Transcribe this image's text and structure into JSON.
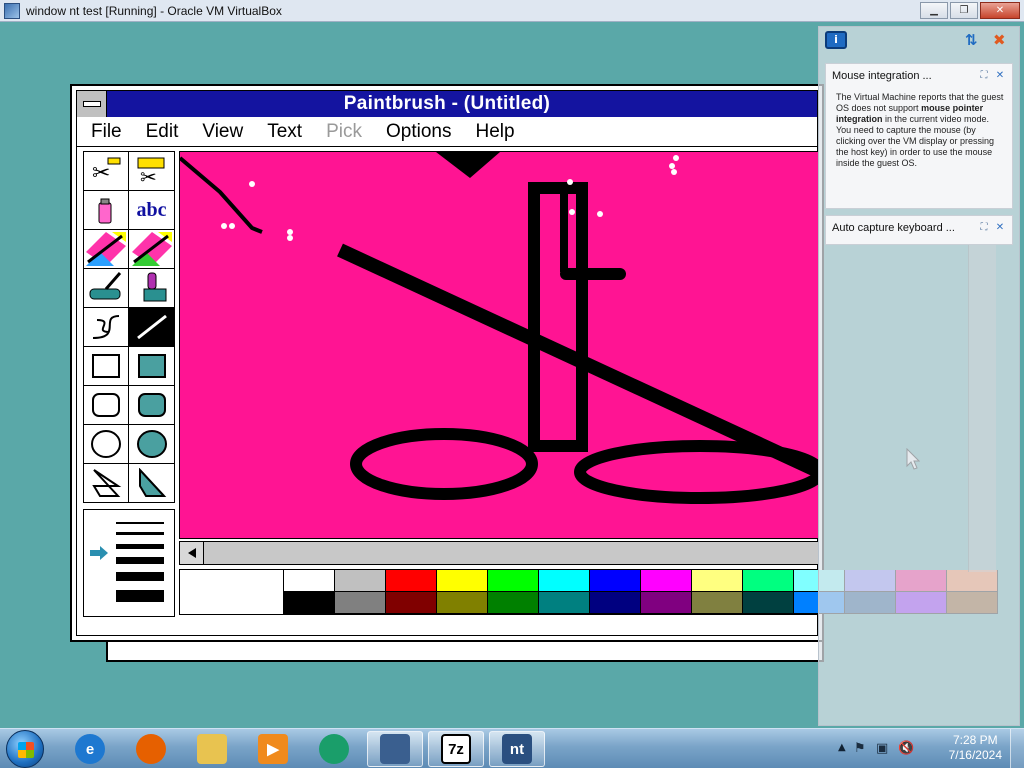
{
  "host": {
    "title": "window nt test [Running] - Oracle VM VirtualBox",
    "icon": "virtualbox-icon",
    "controls": {
      "minimize": "▁",
      "restore": "❐",
      "close": "✕"
    }
  },
  "paintbrush": {
    "title": "Paintbrush - (Untitled)",
    "menu": [
      "File",
      "Edit",
      "View",
      "Text",
      "Pick",
      "Options",
      "Help"
    ],
    "disabled_menu": [
      "Pick"
    ],
    "tools": [
      "scissors-icon",
      "pick-scissors-icon",
      "airbrush-icon",
      "text-tool-icon",
      "color-eraser-icon",
      "eraser-icon",
      "paint-roller-icon",
      "brush-icon",
      "curve-icon",
      "line-icon",
      "box-icon",
      "filled-box-icon",
      "rounded-box-icon",
      "filled-rounded-box-icon",
      "circle-icon",
      "filled-circle-icon",
      "polygon-icon",
      "filled-polygon-icon"
    ],
    "text_tool_label": "abc",
    "selected_tool": "line-icon",
    "canvas_color": "#ff1493",
    "palette_top": [
      "#ffffff",
      "#c0c0c0",
      "#ff0000",
      "#ffff00",
      "#00ff00",
      "#00ffff",
      "#0000ff",
      "#ff00ff",
      "#ffff80",
      "#00ff80",
      "#80ffff",
      "#8080ff",
      "#ff0080",
      "#ff8040"
    ],
    "palette_bottom": [
      "#000000",
      "#808080",
      "#800000",
      "#808000",
      "#008000",
      "#008080",
      "#000080",
      "#800080",
      "#808040",
      "#004040",
      "#0080ff",
      "#004080",
      "#8000ff",
      "#804000"
    ]
  },
  "notifications": {
    "cards": [
      {
        "title": "Mouse integration ...",
        "body_pre": "The Virtual Machine reports that the guest OS does not support ",
        "body_bold": "mouse pointer integration",
        "body_post": " in the current video mode. You need to capture the mouse (by clicking over the VM display or pressing the host key) in order to use the mouse inside the guest OS."
      },
      {
        "title": "Auto capture keyboard ..."
      }
    ]
  },
  "taskbar": {
    "items": [
      {
        "name": "internet-explorer-icon",
        "label": "e",
        "color": "#1e78d0"
      },
      {
        "name": "firefox-icon",
        "label": "",
        "color": "#e66000"
      },
      {
        "name": "file-explorer-icon",
        "label": "",
        "color": "#e8c350"
      },
      {
        "name": "media-player-icon",
        "label": "▶",
        "color": "#f08a1c"
      },
      {
        "name": "media-center-icon",
        "label": "",
        "color": "#1a9e6a"
      },
      {
        "name": "virtualbox-icon",
        "label": "",
        "color": "#3a5f8f"
      },
      {
        "name": "7zip-icon",
        "label": "7z",
        "color": "#000000"
      },
      {
        "name": "windows-nt-vm-icon",
        "label": "nt",
        "color": "#2a4f80"
      }
    ],
    "active_items": [
      "virtualbox-icon",
      "7zip-icon",
      "windows-nt-vm-icon"
    ],
    "clock_time": "7:28 PM",
    "clock_date": "7/16/2024"
  }
}
